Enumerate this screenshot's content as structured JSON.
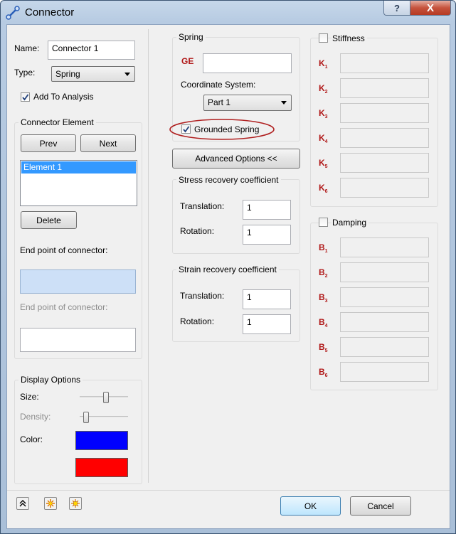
{
  "window": {
    "title": "Connector",
    "help": "?",
    "close": "X"
  },
  "left": {
    "name_label": "Name:",
    "name_value": "Connector 1",
    "type_label": "Type:",
    "type_value": "Spring",
    "add_to_analysis": "Add To Analysis",
    "connector_element_title": "Connector Element",
    "prev": "Prev",
    "next": "Next",
    "elements": [
      "Element 1"
    ],
    "delete": "Delete",
    "end_point_1": "End point of connector:",
    "end_point_2": "End point of connector:",
    "display_options_title": "Display Options",
    "size_label": "Size:",
    "density_label": "Density:",
    "size_level": 0.55,
    "density_level": 0.08,
    "color_label": "Color:",
    "color1": "#0000ff",
    "color2": "#ff0000"
  },
  "spring": {
    "title": "Spring",
    "ge_label": "GE",
    "ge_value": "",
    "coord_label": "Coordinate System:",
    "coord_value": "Part 1",
    "grounded": "Grounded Spring",
    "advanced": "Advanced Options <<",
    "stress_title": "Stress recovery coefficient",
    "stress_translation_label": "Translation:",
    "stress_translation": "1",
    "stress_rotation_label": "Rotation:",
    "stress_rotation": "1",
    "strain_title": "Strain recovery coefficient",
    "strain_translation_label": "Translation:",
    "strain_translation": "1",
    "strain_rotation_label": "Rotation:",
    "strain_rotation": "1"
  },
  "stiffness": {
    "title": "Stiffness",
    "items": [
      {
        "letter": "K",
        "sub": "1"
      },
      {
        "letter": "K",
        "sub": "2"
      },
      {
        "letter": "K",
        "sub": "3"
      },
      {
        "letter": "K",
        "sub": "4"
      },
      {
        "letter": "K",
        "sub": "5"
      },
      {
        "letter": "K",
        "sub": "6"
      }
    ]
  },
  "damping": {
    "title": "Damping",
    "items": [
      {
        "letter": "B",
        "sub": "1"
      },
      {
        "letter": "B",
        "sub": "2"
      },
      {
        "letter": "B",
        "sub": "3"
      },
      {
        "letter": "B",
        "sub": "4"
      },
      {
        "letter": "B",
        "sub": "5"
      },
      {
        "letter": "B",
        "sub": "6"
      }
    ]
  },
  "footer": {
    "ok": "OK",
    "cancel": "Cancel"
  },
  "icons": {
    "collapse": "double-chevron-up-icon",
    "sparkle1": "sparkle-icon",
    "sparkle2": "sparkle-grid-icon"
  },
  "colors": {
    "highlight_circle": "#b02020",
    "selection": "#3399ff"
  }
}
